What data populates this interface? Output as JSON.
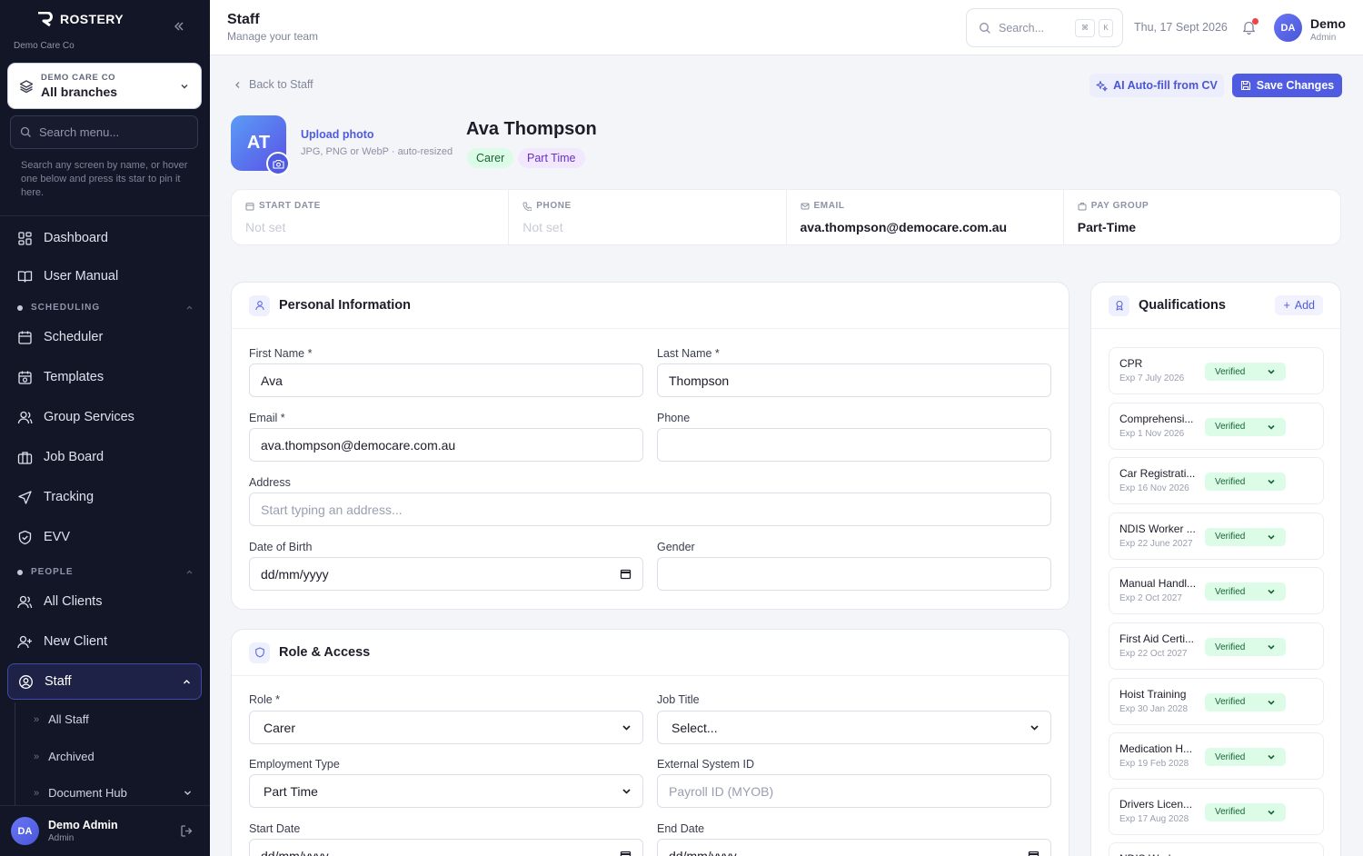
{
  "sidebar": {
    "brand": "ROSTERY",
    "org": "Demo Care Co",
    "branch_org": "DEMO CARE CO",
    "branch_name": "All branches",
    "search_placeholder": "Search menu...",
    "hint": "Search any screen by name, or hover one below and press its star to pin it here.",
    "items": [
      {
        "label": "Dashboard",
        "icon": "dashboard-icon"
      },
      {
        "label": "User Manual",
        "icon": "book-icon"
      }
    ],
    "section_scheduling": "SCHEDULING",
    "scheduling_items": [
      {
        "label": "Scheduler",
        "icon": "calendar-icon"
      },
      {
        "label": "Templates",
        "icon": "calendar-refresh-icon"
      },
      {
        "label": "Group Services",
        "icon": "group-icon"
      },
      {
        "label": "Job Board",
        "icon": "briefcase-icon"
      },
      {
        "label": "Tracking",
        "icon": "navigation-icon"
      },
      {
        "label": "EVV",
        "icon": "shield-check-icon"
      }
    ],
    "section_people": "PEOPLE",
    "people_items": [
      {
        "label": "All Clients",
        "icon": "users-icon"
      },
      {
        "label": "New Client",
        "icon": "user-plus-icon"
      },
      {
        "label": "Staff",
        "icon": "user-circle-icon"
      }
    ],
    "staff_sub": [
      "All Staff",
      "Archived",
      "Document Hub"
    ],
    "footer": {
      "initials": "DA",
      "name": "Demo Admin",
      "role": "Admin"
    }
  },
  "header": {
    "title": "Staff",
    "subtitle": "Manage your team",
    "search_placeholder": "Search...",
    "kbd1": "⌘",
    "kbd2": "K",
    "date": "Thu, 17 Sept 2026",
    "user_initials": "DA",
    "user_name": "Demo",
    "user_role": "Admin"
  },
  "profile": {
    "back": "Back to Staff",
    "ai_button": "AI Auto-fill from CV",
    "save_button": "Save Changes",
    "initials": "AT",
    "upload": "Upload photo",
    "upload_hint": "JPG, PNG or WebP · auto-resized",
    "name": "Ava Thompson",
    "tags": [
      "Carer",
      "Part Time"
    ],
    "tag_colors": [
      "#dcfce7",
      "#f1e8fd"
    ]
  },
  "info": [
    {
      "label": "START DATE",
      "value": "Not set"
    },
    {
      "label": "PHONE",
      "value": "Not set"
    },
    {
      "label": "EMAIL",
      "value": "ava.thompson@democare.com.au"
    },
    {
      "label": "PAY GROUP",
      "value": "Part-Time"
    }
  ],
  "personal": {
    "title": "Personal Information",
    "first_name_label": "First Name *",
    "first_name": "Ava",
    "last_name_label": "Last Name *",
    "last_name": "Thompson",
    "email_label": "Email *",
    "email": "ava.thompson@democare.com.au",
    "phone_label": "Phone",
    "phone": "",
    "address_label": "Address",
    "address_placeholder": "Start typing an address...",
    "dob_label": "Date of Birth",
    "dob": "dd/mm/yyyy",
    "gender_label": "Gender",
    "gender": ""
  },
  "role_access": {
    "title": "Role & Access",
    "role_label": "Role *",
    "role": "Carer",
    "job_title_label": "Job Title",
    "job_title": "Select...",
    "employment_label": "Employment Type",
    "employment": "Part Time",
    "external_label": "External System ID",
    "external_placeholder": "Payroll ID (MYOB)",
    "start_label": "Start Date",
    "start_value": "dd/mm/yyyy",
    "end_label": "End Date",
    "end_value": "dd/mm/yyyy"
  },
  "qualifications": {
    "title": "Qualifications",
    "add": "Add",
    "items": [
      {
        "name": "CPR",
        "exp": "Exp 7 July 2026",
        "status": "Verified"
      },
      {
        "name": "Comprehensi...",
        "exp": "Exp 1 Nov 2026",
        "status": "Verified"
      },
      {
        "name": "Car Registrati...",
        "exp": "Exp 16 Nov 2026",
        "status": "Verified"
      },
      {
        "name": "NDIS Worker ...",
        "exp": "Exp 22 June 2027",
        "status": "Verified"
      },
      {
        "name": "Manual Handl...",
        "exp": "Exp 2 Oct 2027",
        "status": "Verified"
      },
      {
        "name": "First Aid Certi...",
        "exp": "Exp 22 Oct 2027",
        "status": "Verified"
      },
      {
        "name": "Hoist Training",
        "exp": "Exp 30 Jan 2028",
        "status": "Verified"
      },
      {
        "name": "Medication H...",
        "exp": "Exp 19 Feb 2028",
        "status": "Verified"
      },
      {
        "name": "Drivers Licen...",
        "exp": "Exp 17 Aug 2028",
        "status": "Verified"
      },
      {
        "name": "NDIS Worker ...",
        "exp": "",
        "status": ""
      }
    ]
  }
}
